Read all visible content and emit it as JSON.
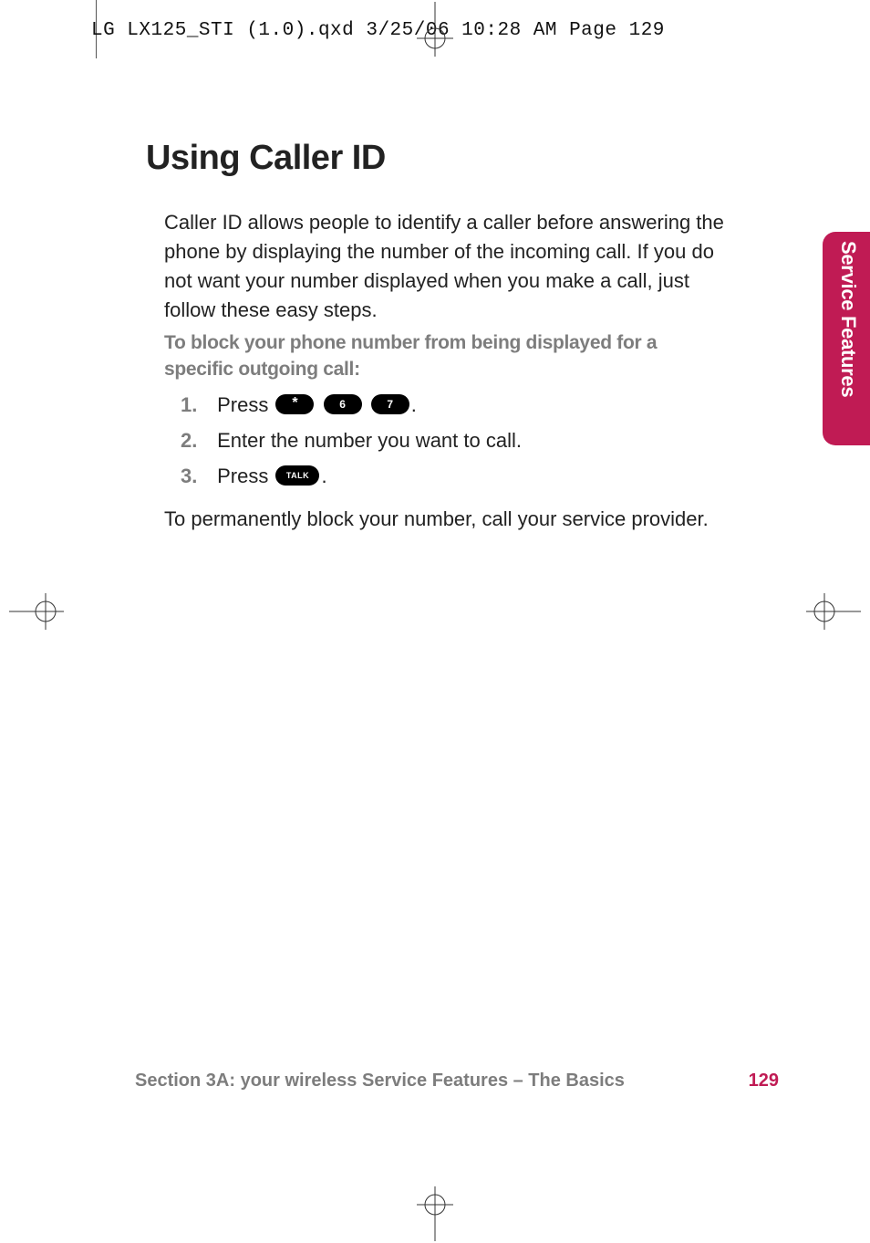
{
  "header": {
    "slug": "LG LX125_STI (1.0).qxd  3/25/06  10:28 AM  Page 129"
  },
  "title": "Using Caller ID",
  "intro": "Caller ID allows people to identify a caller before answering the phone by displaying the number of the incoming call. If you do not want your number displayed when you make a call, just follow these easy steps.",
  "subhead": "To block your phone number from being displayed for a specific outgoing call:",
  "steps": {
    "s1_num": "1.",
    "s1_a": "Press ",
    "s1_key1": "*",
    "s1_key2": "6",
    "s1_key3": "7",
    "s1_b": ".",
    "s2_num": "2.",
    "s2_txt": "Enter the number you want to call.",
    "s3_num": "3.",
    "s3_a": "Press ",
    "s3_key": "TALK",
    "s3_b": "."
  },
  "footnote": "To permanently block your number, call your service provider.",
  "tab": "Service Features",
  "footer": {
    "section": "Section 3A: your wireless Service Features – The Basics",
    "page": "129"
  }
}
